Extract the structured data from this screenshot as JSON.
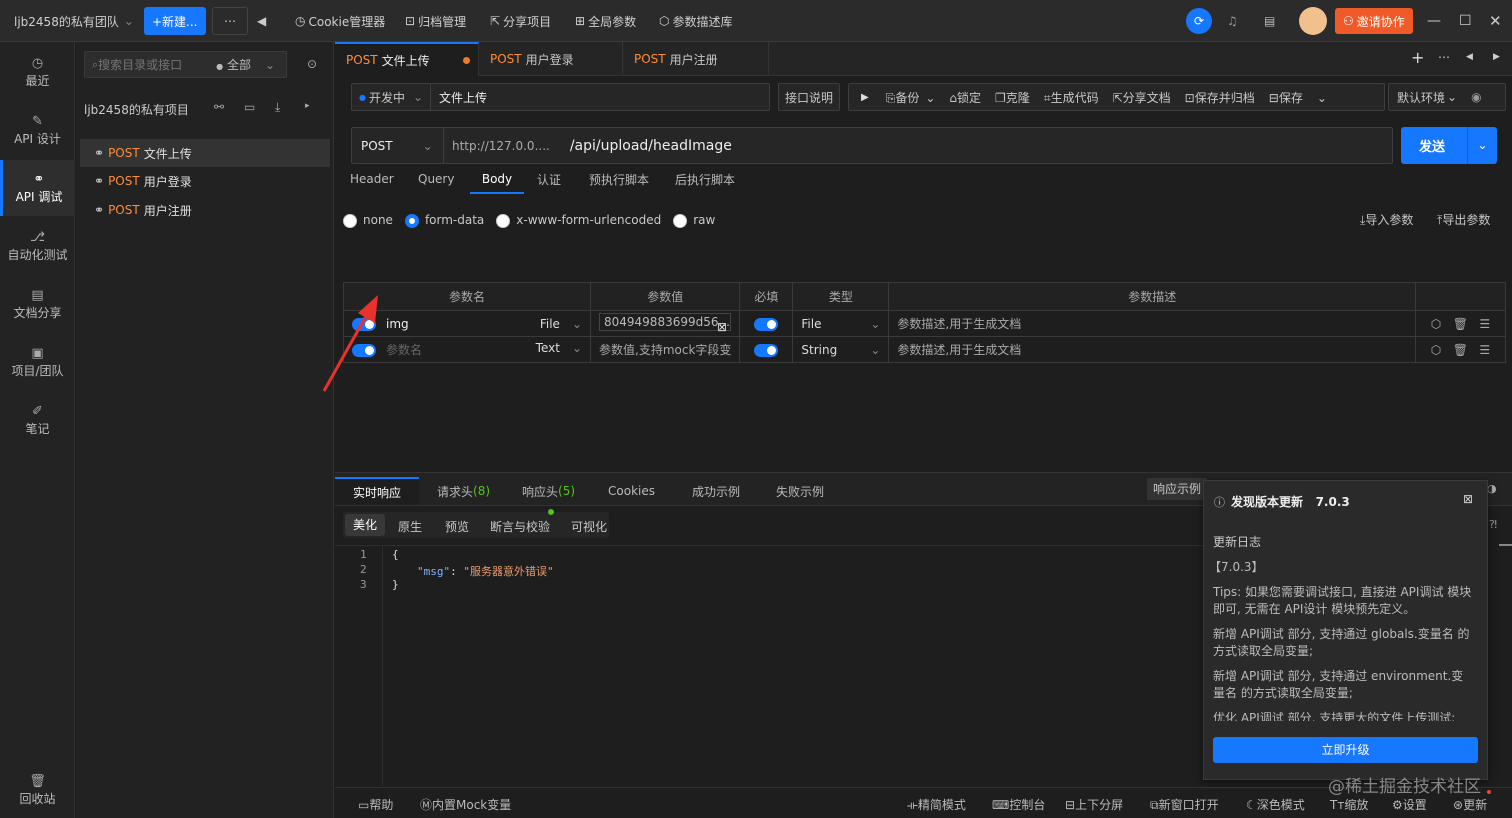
{
  "topbar": {
    "team": "ljb2458的私有团队",
    "new_btn": "+新建...",
    "more": "⋯",
    "cookie": "Cookie管理器",
    "archive": "归档管理",
    "share": "分享项目",
    "global_params": "全局参数",
    "param_desc_lib": "参数描述库",
    "invite": "邀请协作"
  },
  "leftnav": {
    "items": [
      {
        "label": "最近",
        "icon": "clock-icon"
      },
      {
        "label": "API 设计",
        "icon": "edit-icon"
      },
      {
        "label": "API 调试",
        "icon": "link-icon"
      },
      {
        "label": "自动化测试",
        "icon": "flow-icon"
      },
      {
        "label": "文档分享",
        "icon": "doc-icon"
      },
      {
        "label": "项目/团队",
        "icon": "folder-icon"
      },
      {
        "label": "笔记",
        "icon": "note-icon"
      }
    ],
    "recycle": "回收站"
  },
  "sidebar": {
    "search_placeholder": "搜索目录或接口",
    "filter": "全部",
    "project": "ljb2458的私有项目",
    "items": [
      {
        "method": "POST",
        "name": "文件上传"
      },
      {
        "method": "POST",
        "name": "用户登录"
      },
      {
        "method": "POST",
        "name": "用户注册"
      }
    ]
  },
  "tabs": [
    {
      "method": "POST",
      "name": "文件上传"
    },
    {
      "method": "POST",
      "name": "用户登录"
    },
    {
      "method": "POST",
      "name": "用户注册"
    }
  ],
  "toolbar": {
    "status": "开发中",
    "api_name": "文件上传",
    "doc": "接口说明",
    "backup": "备份",
    "lock": "锁定",
    "clone": "克隆",
    "gen_code": "生成代码",
    "share_doc": "分享文档",
    "save_archive": "保存并归档",
    "save": "保存",
    "env": "默认环境"
  },
  "request": {
    "method": "POST",
    "host": "http://127.0.0....",
    "path": "/api/upload/headImage",
    "send": "发送"
  },
  "req_tabs": [
    "Header",
    "Query",
    "Body",
    "认证",
    "预执行脚本",
    "后执行脚本"
  ],
  "body_types": [
    "none",
    "form-data",
    "x-www-form-urlencoded",
    "raw"
  ],
  "import_params": "导入参数",
  "export_params": "导出参数",
  "params_table": {
    "headers": [
      "参数名",
      "参数值",
      "必填",
      "类型",
      "参数描述"
    ],
    "rows": [
      {
        "name": "img",
        "kind": "File",
        "value": "804949883699d56...",
        "type": "File",
        "desc": "参数描述,用于生成文档"
      },
      {
        "name": "参数名",
        "kind": "Text",
        "value": "参数值,支持mock字段变",
        "type": "String",
        "desc": "参数描述,用于生成文档"
      }
    ]
  },
  "resp_tabs": [
    {
      "label": "实时响应"
    },
    {
      "label": "请求头",
      "count": "(8)"
    },
    {
      "label": "响应头",
      "count": "(5)"
    },
    {
      "label": "Cookies"
    },
    {
      "label": "成功示例"
    },
    {
      "label": "失败示例"
    }
  ],
  "resp_example": "响应示例",
  "view_tabs": [
    "美化",
    "原生",
    "预览",
    "断言与校验",
    "可视化"
  ],
  "code_lines": [
    {
      "n": "1",
      "text": "{"
    },
    {
      "n": "2",
      "key": "\"msg\"",
      "val": "\"服务器意外错误\""
    },
    {
      "n": "3",
      "text": "}"
    }
  ],
  "popup": {
    "title": "发现版本更新",
    "version": "7.0.3",
    "log_title": "更新日志",
    "tag": "【7.0.3】",
    "p1": "Tips: 如果您需要调试接口, 直接进 API调试 模块即可, 无需在 API设计 模块预先定义。",
    "p2": "新增 API调试 部分, 支持通过 globals.变量名 的方式读取全局变量;",
    "p3": "新增 API调试 部分, 支持通过 environment.变量名 的方式读取全局变量;",
    "p4": "优化 API调试 部分, 支持更大的文件上传测试;",
    "upgrade": "立即升级"
  },
  "bottombar": {
    "help": "帮助",
    "mock": "内置Mock变量",
    "compact": "精简模式",
    "console": "控制台",
    "split": "上下分屏",
    "new_window": "新窗口打开",
    "dark": "深色模式",
    "zoom": "缩放",
    "settings": "设置",
    "update": "更新",
    "watermark": "@稀土掘金技术社区"
  }
}
